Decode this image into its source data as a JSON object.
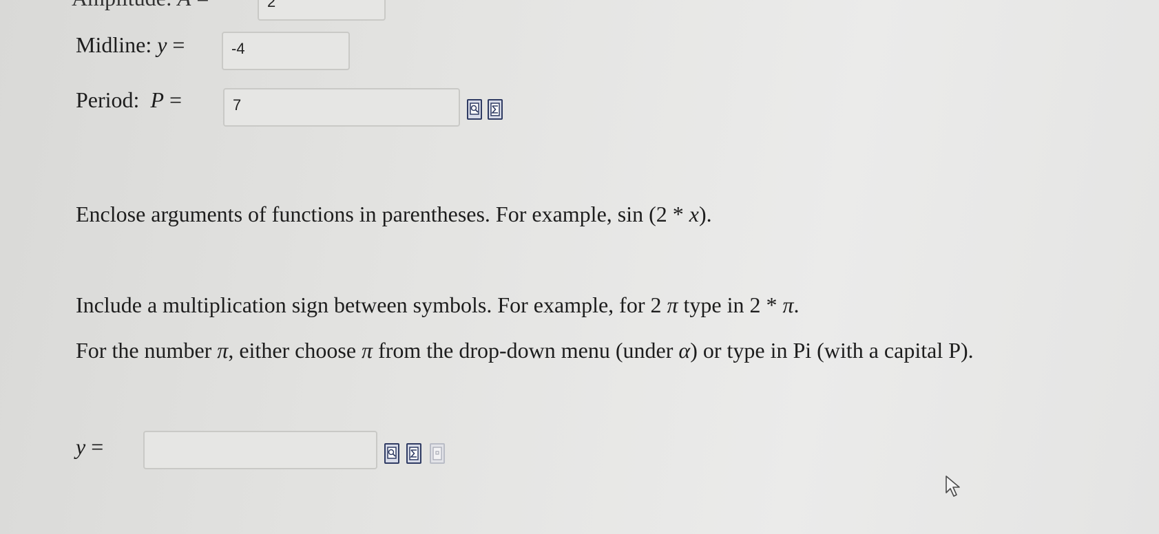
{
  "amplitude": {
    "value": "2"
  },
  "midline": {
    "label": "Midline:",
    "var": "y",
    "eq": "=",
    "value": "-4"
  },
  "period": {
    "label": "Period:",
    "var": "P",
    "eq": "=",
    "value": "7"
  },
  "instructions": {
    "args_a": "Enclose arguments of functions in parentheses. For example,",
    "args_b": "sin (2 * ",
    "args_c": "x",
    "args_d": ").",
    "mult_a": "Include a multiplication sign between symbols. For example, for 2",
    "mult_pi": "π",
    "mult_b": " type in  2 * ",
    "mult_pi2": "π",
    "mult_c": ".",
    "pi_a": "For the number ",
    "pi_sym": "π",
    "pi_b": ", either choose ",
    "pi_sym2": "π",
    "pi_c": " from the drop-down menu (under ",
    "alpha": "α",
    "pi_d": ") or type in Pi (with a capital P)."
  },
  "answer": {
    "var": "y",
    "eq": "=",
    "value": ""
  },
  "icons": [
    "preview-icon",
    "equation-editor-icon",
    "help-icon"
  ]
}
